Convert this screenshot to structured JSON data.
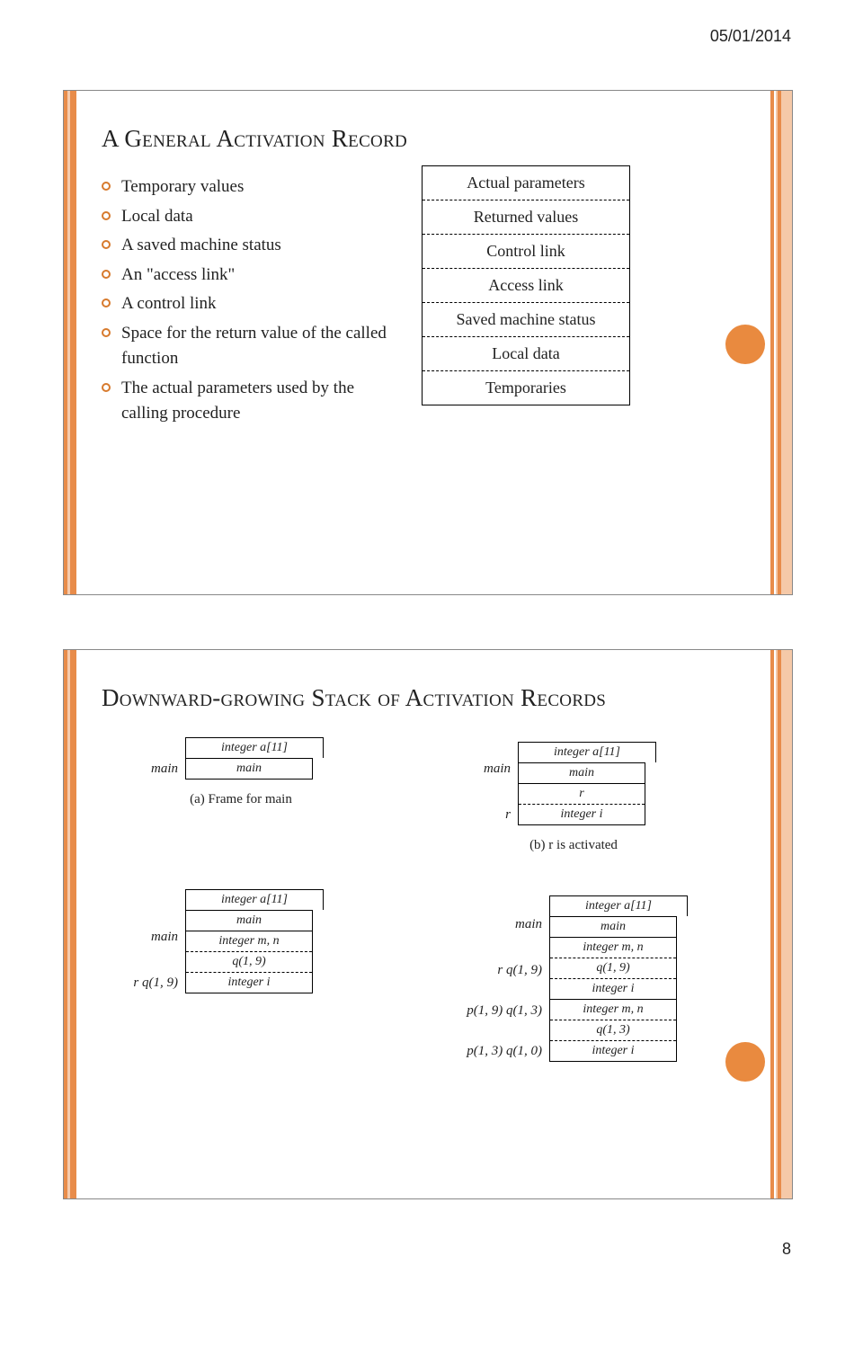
{
  "header": {
    "date": "05/01/2014",
    "page_number": "8"
  },
  "slide1": {
    "title": "A General Activation Record",
    "bullets": [
      "Temporary values",
      "Local data",
      "A saved machine status",
      "An \"access link\"",
      "A control link",
      "Space for the return value of the called function",
      "The actual parameters used by the calling procedure"
    ],
    "record": [
      "Actual parameters",
      "Returned values",
      "Control link",
      "Access link",
      "Saved machine status",
      "Local data",
      "Temporaries"
    ]
  },
  "slide2": {
    "title": "Downward-growing Stack of Activation Records",
    "panels": {
      "a": {
        "caption": "(a) Frame for main",
        "labels_left": [
          "main"
        ],
        "above": "integer a[11]",
        "cells": [
          "main"
        ]
      },
      "b": {
        "caption": "(b) r is activated",
        "labels_left": [
          "main",
          "r"
        ],
        "above": "integer a[11]",
        "cells": [
          "main",
          "r",
          "integer i"
        ]
      },
      "c": {
        "labels_left": [
          "main",
          "r     q(1, 9)"
        ],
        "above": "integer a[11]",
        "cells": [
          "main",
          "integer m, n",
          "q(1, 9)",
          "integer i"
        ]
      },
      "d": {
        "labels_left": [
          "main",
          "r     q(1, 9)",
          "p(1, 9)  q(1, 3)",
          "p(1, 3)  q(1, 0)"
        ],
        "above": "integer a[11]",
        "cells": [
          "main",
          "integer m, n",
          "q(1, 9)",
          "integer i",
          "integer m, n",
          "q(1, 3)",
          "integer i"
        ]
      }
    }
  }
}
